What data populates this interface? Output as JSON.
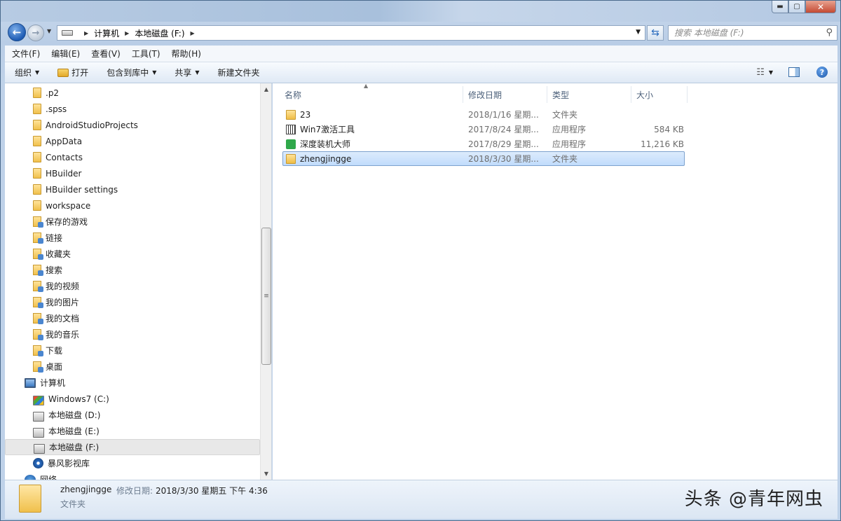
{
  "window": {
    "minimize": "▬",
    "maximize": "▢",
    "close": "✕"
  },
  "address": {
    "crumbs": [
      "计算机",
      "本地磁盘 (F:)"
    ],
    "search_placeholder": "搜索 本地磁盘 (F:)"
  },
  "menu": [
    "文件(F)",
    "编辑(E)",
    "查看(V)",
    "工具(T)",
    "帮助(H)"
  ],
  "commands": {
    "organize": "组织",
    "open": "打开",
    "include_library": "包含到库中",
    "share": "共享",
    "new_folder": "新建文件夹"
  },
  "tree": [
    {
      "label": ".p2",
      "icon": "folder-icon"
    },
    {
      "label": ".spss",
      "icon": "folder-icon"
    },
    {
      "label": "AndroidStudioProjects",
      "icon": "folder-icon"
    },
    {
      "label": "AppData",
      "icon": "folder-icon"
    },
    {
      "label": "Contacts",
      "icon": "folder-icon"
    },
    {
      "label": "HBuilder",
      "icon": "folder-icon"
    },
    {
      "label": "HBuilder settings",
      "icon": "folder-icon"
    },
    {
      "label": "workspace",
      "icon": "folder-icon"
    },
    {
      "label": "保存的游戏",
      "icon": "special-folder-icon"
    },
    {
      "label": "链接",
      "icon": "special-folder-icon"
    },
    {
      "label": "收藏夹",
      "icon": "special-folder-icon"
    },
    {
      "label": "搜索",
      "icon": "special-folder-icon"
    },
    {
      "label": "我的视频",
      "icon": "special-folder-icon"
    },
    {
      "label": "我的图片",
      "icon": "special-folder-icon"
    },
    {
      "label": "我的文档",
      "icon": "special-folder-icon"
    },
    {
      "label": "我的音乐",
      "icon": "special-folder-icon"
    },
    {
      "label": "下载",
      "icon": "special-folder-icon"
    },
    {
      "label": "桌面",
      "icon": "special-folder-icon"
    },
    {
      "label": "计算机",
      "icon": "computer-icon"
    },
    {
      "label": "Windows7 (C:)",
      "icon": "windows-drive-icon"
    },
    {
      "label": "本地磁盘 (D:)",
      "icon": "drive-icon"
    },
    {
      "label": "本地磁盘 (E:)",
      "icon": "drive-icon"
    },
    {
      "label": "本地磁盘 (F:)",
      "icon": "drive-icon"
    },
    {
      "label": "暴风影视库",
      "icon": "media-library-icon"
    },
    {
      "label": "网络",
      "icon": "network-icon"
    }
  ],
  "columns": [
    "名称",
    "修改日期",
    "类型",
    "大小"
  ],
  "files": [
    {
      "name": "23",
      "date": "2018/1/16 星期...",
      "type": "文件夹",
      "size": "",
      "icon": "folder"
    },
    {
      "name": "Win7激活工具",
      "date": "2017/8/24 星期...",
      "type": "应用程序",
      "size": "584 KB",
      "icon": "exe1"
    },
    {
      "name": "深度装机大师",
      "date": "2017/8/29 星期...",
      "type": "应用程序",
      "size": "11,216 KB",
      "icon": "exe2"
    },
    {
      "name": "zhengjingge",
      "date": "2018/3/30 星期...",
      "type": "文件夹",
      "size": "",
      "icon": "folder"
    }
  ],
  "details": {
    "name": "zhengjingge",
    "modified_label": "修改日期:",
    "modified_value": "2018/3/30 星期五 下午 4:36",
    "type": "文件夹"
  },
  "watermark": "头条 @青年网虫"
}
